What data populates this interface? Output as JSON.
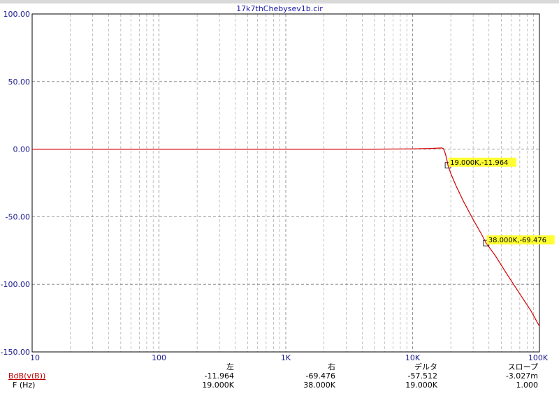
{
  "window": {
    "title": "17k7thChebysev1b.cir"
  },
  "chart_data": {
    "type": "line",
    "title": "17k7thChebysev1b.cir",
    "xlabel": "",
    "ylabel": "",
    "xscale": "log",
    "xlim": [
      10,
      100000
    ],
    "ylim": [
      -150,
      100
    ],
    "grid": true,
    "yticks": [
      100,
      50,
      0,
      -50,
      -100,
      -150
    ],
    "ytick_labels": [
      "100.00",
      "50.00",
      "0.00",
      "-50.00",
      "-100.00",
      "-150.00"
    ],
    "xticks": [
      10,
      100,
      1000,
      10000,
      100000
    ],
    "xtick_labels": [
      "10",
      "100",
      "1K",
      "10K",
      "100K"
    ],
    "series": [
      {
        "name": "BdB(v(B))",
        "color": "#d40000",
        "x": [
          10,
          100,
          1000,
          5000,
          10000,
          14000,
          16000,
          17000,
          17500,
          18000,
          18500,
          19000,
          20000,
          22000,
          25000,
          30000,
          35000,
          38000,
          45000,
          55000,
          70000,
          85000,
          100000
        ],
        "y": [
          0,
          0,
          0,
          0,
          0.2,
          0.5,
          0.8,
          0.9,
          0.3,
          -2.5,
          -6.5,
          -11.964,
          -18,
          -27,
          -38,
          -52,
          -63,
          -69.476,
          -79,
          -92,
          -107,
          -119,
          -131
        ]
      }
    ],
    "annotations": [
      {
        "x": 19000,
        "y": -11.964,
        "text": "19.000K,-11.964"
      },
      {
        "x": 38000,
        "y": -69.476,
        "text": "38.000K,-69.476"
      }
    ]
  },
  "cursor_table": {
    "headers": [
      "左",
      "右",
      "デルタ",
      "スロープ"
    ],
    "rows": [
      {
        "label": "BdB(v(B))",
        "values": [
          "-11.964",
          "-69.476",
          "-57.512",
          "-3.027m"
        ]
      },
      {
        "label": "F (Hz)",
        "values": [
          "19.000K",
          "38.000K",
          "19.000K",
          "1.000"
        ]
      }
    ]
  }
}
